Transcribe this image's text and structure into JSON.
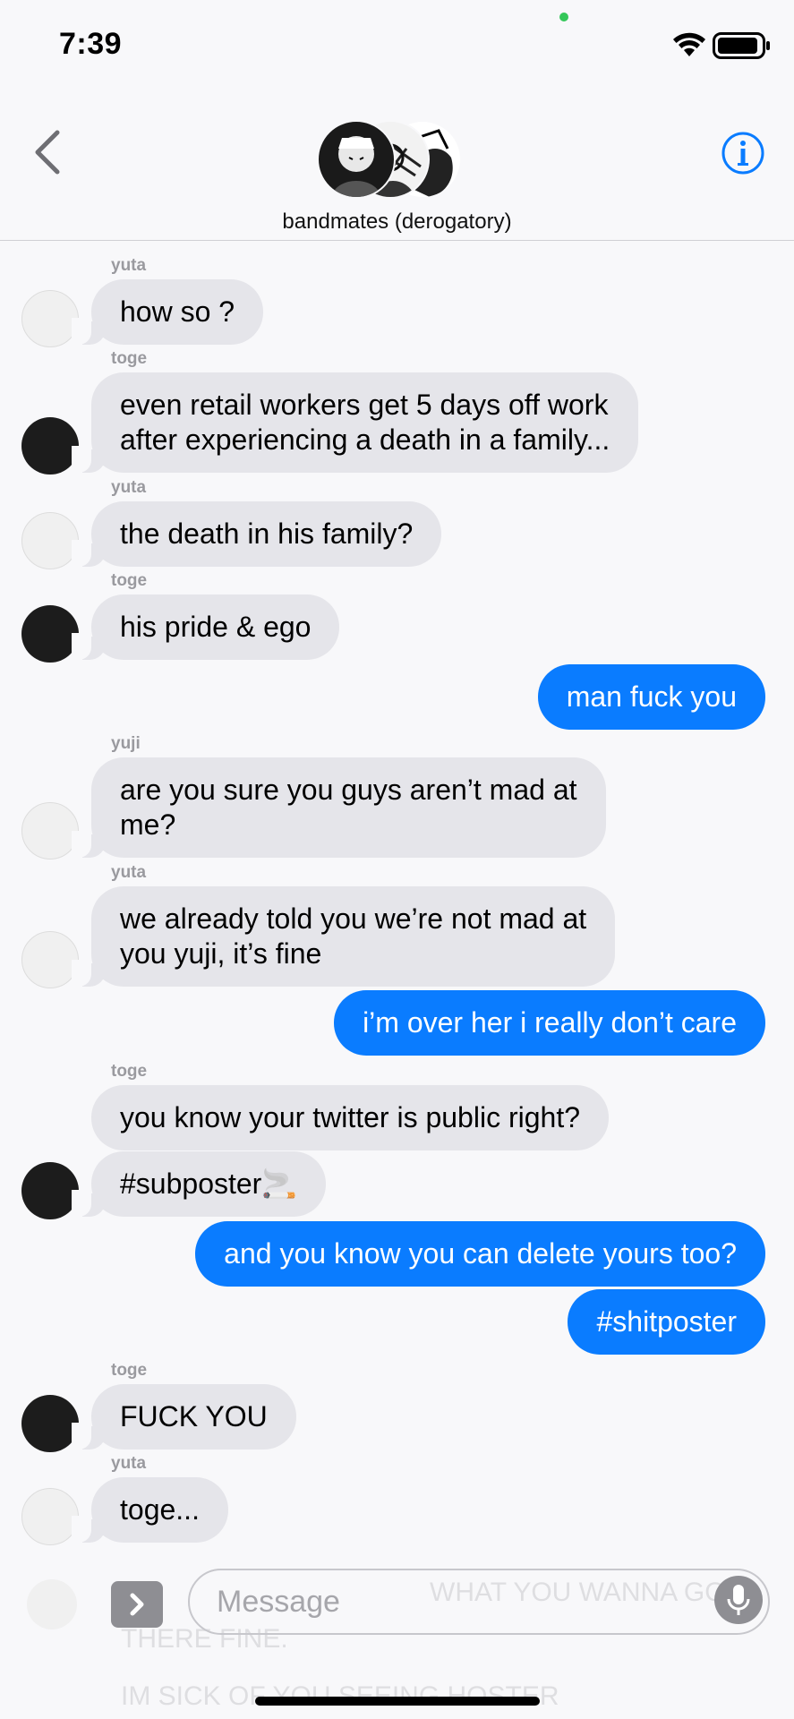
{
  "status_bar": {
    "time": "7:39"
  },
  "header": {
    "group_name": "bandmates (derogatory)"
  },
  "messages": [
    {
      "sender": "yuta",
      "text": "how so ?",
      "direction": "in"
    },
    {
      "sender": "toge",
      "text": "even retail workers get 5 days off work\nafter experiencing a death in a family...",
      "direction": "in"
    },
    {
      "sender": "yuta",
      "text": "the death in his family?",
      "direction": "in"
    },
    {
      "sender": "toge",
      "text": "his pride & ego",
      "direction": "in"
    },
    {
      "sender": "",
      "text": "man fuck you",
      "direction": "out"
    },
    {
      "sender": "yuji",
      "text": "are you sure you guys aren’t mad at\nme?",
      "direction": "in"
    },
    {
      "sender": "yuta",
      "text": "we already told you we’re not mad at\nyou yuji, it’s fine",
      "direction": "in"
    },
    {
      "sender": "",
      "text": "i’m over her i really don’t care",
      "direction": "out"
    },
    {
      "sender": "toge",
      "text": "you know your twitter is public right?",
      "direction": "in"
    },
    {
      "sender": "",
      "text": "#subposter🚬",
      "direction": "in"
    },
    {
      "sender": "",
      "text": "and you know you can delete yours too?",
      "direction": "out"
    },
    {
      "sender": "",
      "text": "#shitposter",
      "direction": "out"
    },
    {
      "sender": "toge",
      "text": "FUCK YOU",
      "direction": "in"
    },
    {
      "sender": "yuta",
      "text": "toge...",
      "direction": "in"
    }
  ],
  "composer": {
    "placeholder": "Message",
    "ghost_lines": [
      "WHAT YOU WANNA GO",
      "THERE FINE.",
      "IM SICK OF YOU SEEING HOSTER"
    ]
  },
  "icons": {
    "back": "chevron-left-icon",
    "info": "info-icon",
    "apps": "chevron-right-icon",
    "mic": "microphone-icon",
    "wifi": "wifi-icon",
    "battery": "battery-icon"
  },
  "colors": {
    "accent": "#0a7cff",
    "incoming_bubble": "#e5e5ea",
    "outgoing_bubble": "#0a7cff",
    "sender_label": "#9a9a9f"
  }
}
